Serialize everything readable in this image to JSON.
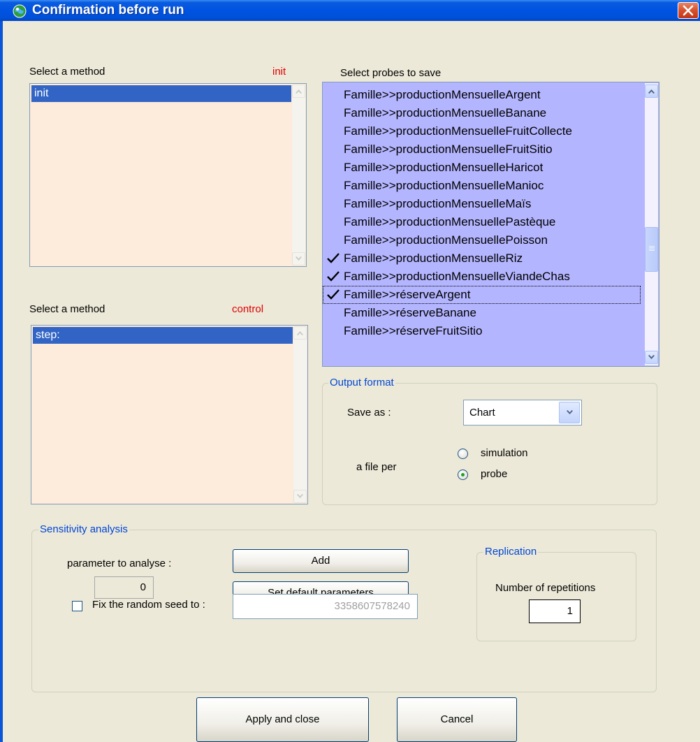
{
  "window": {
    "title": "Confirmation before run",
    "app_icon": "globe-icon",
    "close_icon": "close-icon"
  },
  "method_init": {
    "label": "Select a method",
    "tag": "init",
    "items": [
      "init"
    ],
    "selected": "init"
  },
  "method_control": {
    "label": "Select a method",
    "tag": "control",
    "items": [
      "step:"
    ],
    "selected": "step:"
  },
  "probes": {
    "label": "Select probes to save",
    "items": [
      {
        "label": "Famille>>productionMensuelleArgent",
        "checked": false
      },
      {
        "label": "Famille>>productionMensuelleBanane",
        "checked": false
      },
      {
        "label": "Famille>>productionMensuelleFruitCollecte",
        "checked": false
      },
      {
        "label": "Famille>>productionMensuelleFruitSitio",
        "checked": false
      },
      {
        "label": "Famille>>productionMensuelleHaricot",
        "checked": false
      },
      {
        "label": "Famille>>productionMensuelleManioc",
        "checked": false
      },
      {
        "label": "Famille>>productionMensuelleMaïs",
        "checked": false
      },
      {
        "label": "Famille>>productionMensuellePastèque",
        "checked": false
      },
      {
        "label": "Famille>>productionMensuellePoisson",
        "checked": false
      },
      {
        "label": "Famille>>productionMensuelleRiz",
        "checked": true
      },
      {
        "label": "Famille>>productionMensuelleViandeChas",
        "checked": true
      },
      {
        "label": "Famille>>réserveArgent",
        "checked": true
      },
      {
        "label": "Famille>>réserveBanane",
        "checked": false
      },
      {
        "label": "Famille>>réserveFruitSitio",
        "checked": false
      }
    ],
    "focused_index": 11,
    "scroll_position": 0.55
  },
  "output_format": {
    "title": "Output format",
    "save_as_label": "Save as :",
    "save_as_value": "Chart",
    "file_per_label": "a file per",
    "options": [
      "simulation",
      "probe"
    ],
    "selected_option": "probe"
  },
  "sensitivity": {
    "title": "Sensitivity analysis",
    "param_label": "parameter to analyse :",
    "param_value": "0",
    "add_button": "Add",
    "default_button": "Set default parameters",
    "seed_checkbox_label": "Fix the random seed to :",
    "seed_checked": false,
    "seed_value": "3358607578240"
  },
  "replication": {
    "title": "Replication",
    "label": "Number of repetitions",
    "value": "1"
  },
  "footer": {
    "apply_button": "Apply and close",
    "cancel_button": "Cancel"
  },
  "colors": {
    "titlebar": "#0053E1",
    "list_bg": "#FDEBDB",
    "probe_bg": "#B4B5FF",
    "selection": "#3164C5",
    "group_title": "#0046D5",
    "tag_red": "#E00000"
  }
}
